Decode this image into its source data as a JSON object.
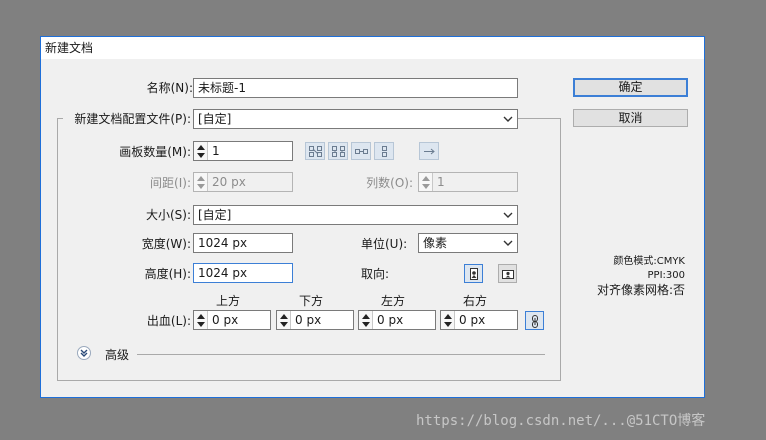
{
  "window": {
    "title": "新建文档"
  },
  "name": {
    "label": "名称(N):",
    "value": "未标题-1"
  },
  "profile": {
    "label": "新建文档配置文件(P):",
    "value": "[自定]"
  },
  "artboards": {
    "count_label": "画板数量(M):",
    "count_value": "1",
    "spacing_label": "间距(I):",
    "spacing_value": "20 px",
    "columns_label": "列数(O):",
    "columns_value": "1"
  },
  "size": {
    "label": "大小(S):",
    "value": "[自定]"
  },
  "width": {
    "label": "宽度(W):",
    "value": "1024 px"
  },
  "units": {
    "label": "单位(U):",
    "value": "像素"
  },
  "height": {
    "label": "高度(H):",
    "value": "1024 px"
  },
  "orientation": {
    "label": "取向:"
  },
  "bleed": {
    "label": "出血(L):",
    "top_label": "上方",
    "top_value": "0 px",
    "bottom_label": "下方",
    "bottom_value": "0 px",
    "left_label": "左方",
    "left_value": "0 px",
    "right_label": "右方",
    "right_value": "0 px"
  },
  "advanced": {
    "label": "高级"
  },
  "buttons": {
    "ok": "确定",
    "cancel": "取消"
  },
  "info": {
    "color_mode": "颜色模式:CMYK",
    "ppi": "PPI:300",
    "pixel_grid": "对齐像素网格:否"
  },
  "watermark": "https://blog.csdn.net/...@51CTO博客"
}
